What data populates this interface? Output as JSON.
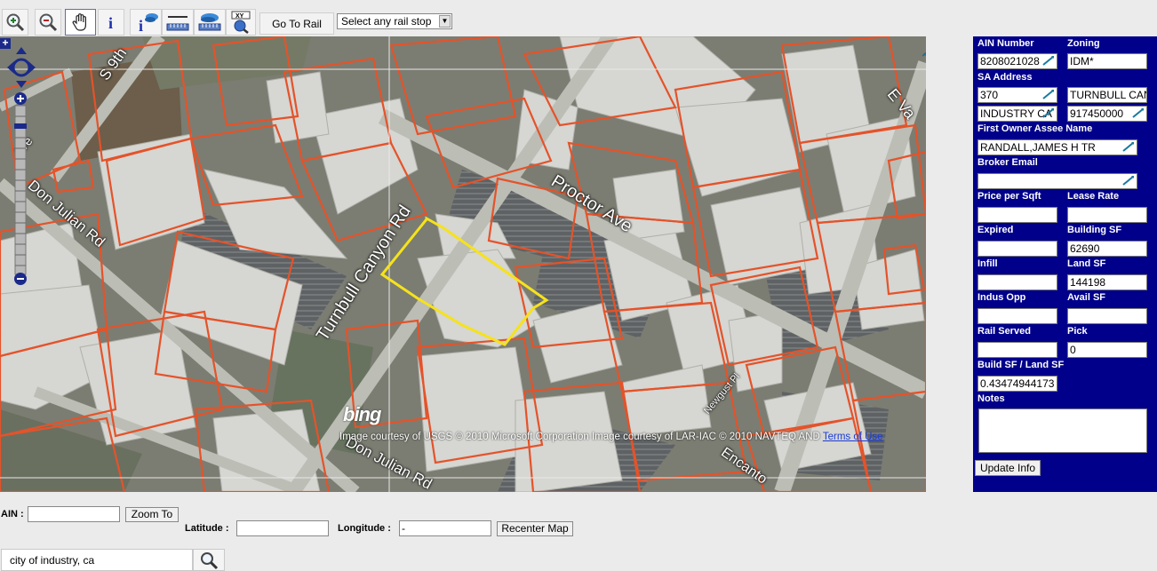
{
  "toolbar": {
    "tools": [
      {
        "name": "zoom-in-tool",
        "icon": "magnifier-plus-icon"
      },
      {
        "name": "zoom-out-tool",
        "icon": "magnifier-minus-icon"
      },
      {
        "name": "pan-tool",
        "icon": "hand-icon"
      },
      {
        "name": "identify-tool",
        "icon": "info-icon"
      },
      {
        "name": "identify-layer-tool",
        "icon": "info-layer-icon"
      },
      {
        "name": "measure-tool",
        "icon": "ruler-icon"
      },
      {
        "name": "measure-area-tool",
        "icon": "ruler-area-icon"
      },
      {
        "name": "xy-tool",
        "icon": "xy-icon"
      }
    ],
    "go_to_rail_label": "Go To Rail",
    "rail_stop_select": "Select any rail stop"
  },
  "map": {
    "road_labels": {
      "s9th": "S 9th",
      "ave_left": "Ave",
      "don_julian_top": "Don Julian Rd",
      "turnbull": "Turnbull Canyon Rd",
      "proctor": "Proctor Ave",
      "don_julian_bottom": "Don Julian Rd",
      "e_va": "E Va",
      "newgust": "Newgust Pl",
      "encanto": "Encanto"
    },
    "bing_logo": "bing",
    "attribution": "Image courtesy of USGS © 2010 Microsoft Corporation Image courtesy of LAR-IAC © 2010 NAVTEQ AND",
    "terms_link": "Terms of Use",
    "colors": {
      "parcel": "#e4532a",
      "selected": "#f6e21c"
    }
  },
  "panel": {
    "ain_number_label": "AIN Number",
    "ain_number_value": "8208021028",
    "zoning_label": "Zoning",
    "zoning_value": "IDM*",
    "sa_address_label": "SA Address",
    "sa_house": "370",
    "sa_street": "TURNBULL CAN",
    "sa_city": "INDUSTRY CA",
    "sa_zip": "917450000",
    "owner_label": "First Owner Assee Name",
    "owner_value": "RANDALL,JAMES H TR",
    "broker_label": "Broker Email",
    "broker_value": "",
    "price_label": "Price per Sqft",
    "price_value": "",
    "lease_label": "Lease Rate",
    "lease_value": "",
    "expired_label": "Expired",
    "expired_value": "",
    "building_sf_label": "Building SF",
    "building_sf_value": "62690",
    "infill_label": "Infill",
    "infill_value": "",
    "land_sf_label": "Land SF",
    "land_sf_value": "144198",
    "indus_opp_label": "Indus Opp",
    "indus_opp_value": "",
    "avail_sf_label": "Avail SF",
    "avail_sf_value": "",
    "rail_served_label": "Rail Served",
    "rail_served_value": "",
    "pick_label": "Pick",
    "pick_value": "0",
    "ratio_label": "Build SF / Land SF",
    "ratio_value": "0.43474944173",
    "notes_label": "Notes",
    "notes_value": "",
    "update_label": "Update Info"
  },
  "bottom": {
    "ain_label": "AIN :",
    "ain_value": "",
    "zoom_to_label": "Zoom To",
    "latitude_label": "Latitude :",
    "latitude_value": "",
    "longitude_label": "Longitude :",
    "longitude_value": "-",
    "recenter_label": "Recenter Map",
    "search_value": "city of industry, ca"
  }
}
